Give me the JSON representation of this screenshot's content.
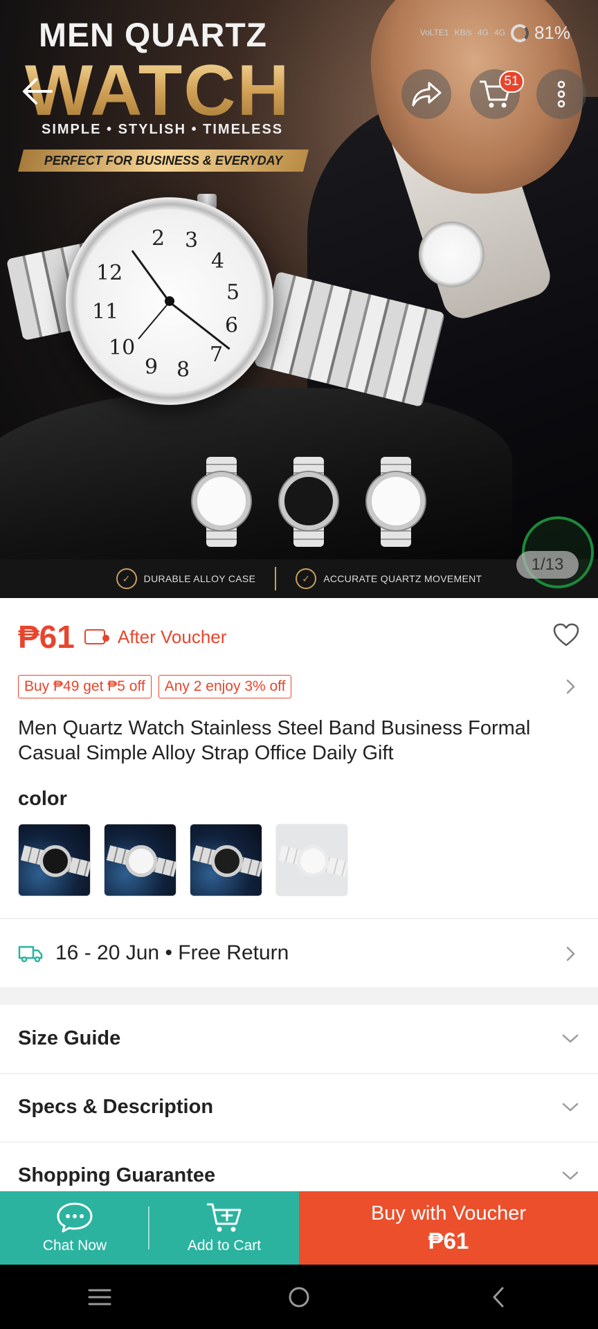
{
  "status_bar": {
    "network_1": "VoLTE1",
    "network_2": "KB/s",
    "network_3": "4G",
    "network_4": "4G",
    "battery": "81%"
  },
  "hero": {
    "title_line1": "MEN QUARTZ",
    "title_line2": "WATCH",
    "tagline": "SIMPLE • STYLISH • TIMELESS",
    "banner": "PERFECT FOR BUSINESS & EVERYDAY",
    "feature_1": "DURABLE ALLOY CASE",
    "feature_2": "ACCURATE QUARTZ MOVEMENT",
    "image_counter": "1/13",
    "cart_count": "51"
  },
  "product": {
    "price": "₱61",
    "after_voucher": "After Voucher",
    "promo_tags": [
      "Buy ₱49 get ₱5 off",
      "Any 2 enjoy 3% off"
    ],
    "title": "Men Quartz Watch Stainless Steel Band Business Formal Casual Simple Alloy Strap Office Daily Gift",
    "color_label": "color"
  },
  "delivery": {
    "text": "16 - 20 Jun • Free Return"
  },
  "sections": {
    "size_guide": "Size Guide",
    "specs": "Specs & Description",
    "guarantee": "Shopping Guarantee"
  },
  "actions": {
    "chat_now": "Chat Now",
    "add_to_cart": "Add to Cart",
    "buy_label": "Buy with Voucher",
    "buy_price": "₱61"
  },
  "colors": {
    "accent": "#e8452c",
    "teal": "#2bb39f",
    "buy": "#ec4f2c",
    "gold": "#c8a15e"
  },
  "icons": [
    "back-arrow-icon",
    "share-icon",
    "cart-icon",
    "more-icon",
    "heart-icon",
    "voucher-icon",
    "chevron-right-icon",
    "truck-icon",
    "chevron-down-icon",
    "chat-icon",
    "add-cart-icon",
    "menu-icon",
    "home-icon",
    "back-icon"
  ]
}
